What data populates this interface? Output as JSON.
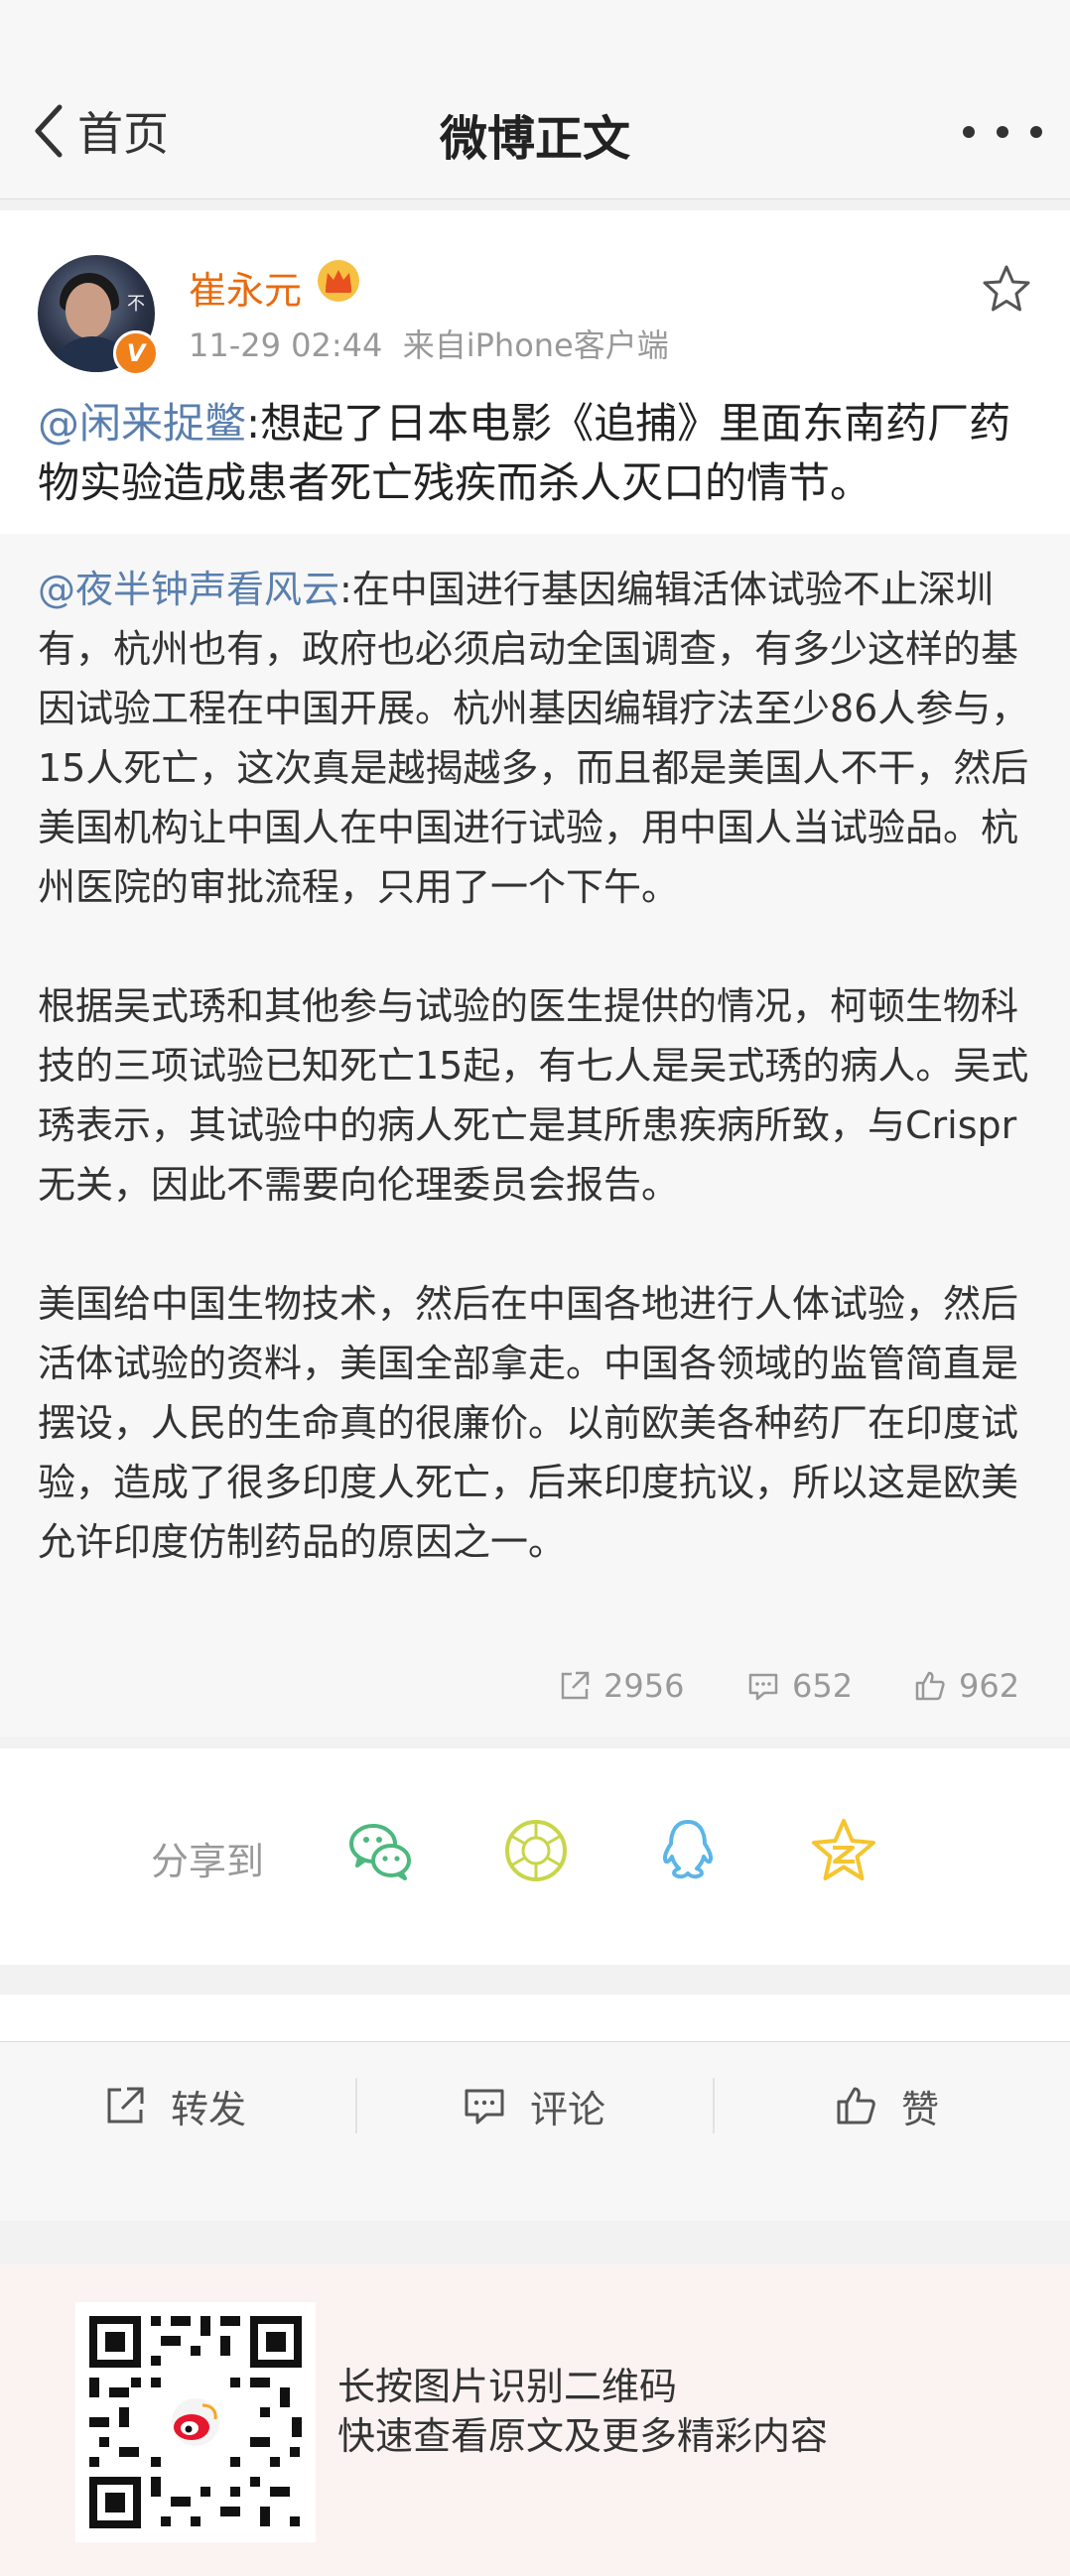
{
  "nav": {
    "back_label": "首页",
    "title": "微博正文"
  },
  "post": {
    "username": "崔永元",
    "avatar_text": "不如",
    "verified_badge": "V",
    "time": "11-29 02:44",
    "source": "来自iPhone客户端",
    "mention": "@闲来捉鳖",
    "text": ":想起了日本电影《追捕》里面东南药厂药物实验造成患者死亡残疾而杀人灭口的情节。"
  },
  "retweet": {
    "mention": "@夜半钟声看风云",
    "paragraph1": ":在中国进行基因编辑活体试验不止深圳有，杭州也有，政府也必须启动全国调查，有多少这样的基因试验工程在中国开展。杭州基因编辑疗法至少86人参与，15人死亡，这次真是越揭越多，而且都是美国人不干，然后美国机构让中国人在中国进行试验，用中国人当试验品。杭州医院的审批流程，只用了一个下午。",
    "paragraph2": "根据吴式琇和其他参与试验的医生提供的情况，柯顿生物科技的三项试验已知死亡15起，有七人是吴式琇的病人。吴式琇表示，其试验中的病人死亡是其所患疾病所致，与Crispr无关，因此不需要向伦理委员会报告。",
    "paragraph3": "美国给中国生物技术，然后在中国各地进行人体试验，然后活体试验的资料，美国全部拿走。中国各领域的监管简直是摆设，人民的生命真的很廉价。以前欧美各种药厂在印度试验，造成了很多印度人死亡，后来印度抗议，所以这是欧美允许印度仿制药品的原因之一。",
    "reposts": "2956",
    "comments": "652",
    "likes": "962"
  },
  "share": {
    "label": "分享到",
    "targets": [
      "wechat-icon",
      "moments-icon",
      "qq-icon",
      "qzone-icon"
    ]
  },
  "actions": {
    "repost": "转发",
    "comment": "评论",
    "like": "赞"
  },
  "footer": {
    "line1": "长按图片识别二维码",
    "line2": "快速查看原文及更多精彩内容"
  },
  "colors": {
    "mention": "#5a7fae",
    "username": "#e86b0f",
    "wechat": "#4cb87e",
    "moments": "#c8d548",
    "qq": "#5cb5e8",
    "qzone": "#f5c52f"
  }
}
